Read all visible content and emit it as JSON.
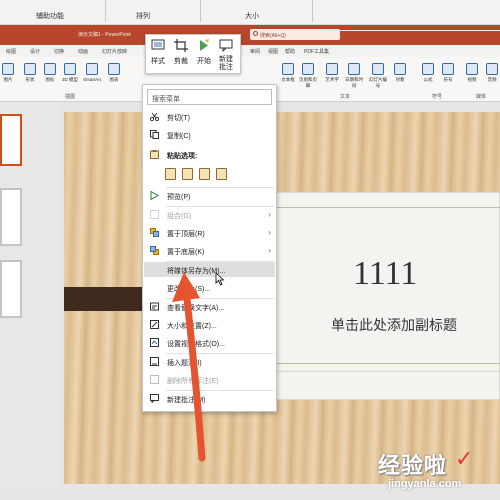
{
  "top_strip": {
    "group1": "辅助功能",
    "group2": "排列",
    "group3": "大小"
  },
  "titlebar": {
    "title": "演示文稿1 - PowerPoint",
    "search_placeholder": "搜索(Alt+Q)"
  },
  "tabs": [
    "绘图",
    "设计",
    "切换",
    "动画",
    "幻灯片放映",
    "审阅",
    "视图",
    "帮助",
    "PDF工具集"
  ],
  "ribbon": {
    "items": [
      "图片",
      "形状",
      "图标",
      "3D 模型",
      "SmartArt",
      "图表",
      "文本框",
      "页眉和页脚",
      "艺术字",
      "日期和时间",
      "幻灯片编号",
      "对象",
      "公式",
      "符号",
      "视频",
      "音频"
    ],
    "groups": {
      "illustrations": "插图",
      "text": "文本",
      "symbols": "符号",
      "media": "媒体"
    }
  },
  "mini_toolbar": {
    "style": "样式",
    "crop": "剪裁",
    "start": "开始",
    "new_comment": "新建批注"
  },
  "slide": {
    "title": "1111",
    "subtitle": "单击此处添加副标题"
  },
  "context_menu": {
    "search_placeholder": "搜索菜单",
    "items": {
      "cut": "剪切(T)",
      "copy": "复制(C)",
      "paste_options": "粘贴选项:",
      "preview": "预览(P)",
      "group": "组合(G)",
      "bring_front": "置于顶层(R)",
      "send_back": "置于底层(K)",
      "save_as_picture": "将媒体另存为(M)...",
      "change_picture": "更改图片(S)...",
      "edit_alt_text": "查看替换文字(A)...",
      "size_position": "大小和位置(Z)...",
      "format_video": "设置视频格式(O)...",
      "insert_caption": "插入题注(I)",
      "remove_captions": "删除所有标注(E)",
      "new_comment": "新建批注(M)"
    }
  },
  "watermark": {
    "line1": "经验啦",
    "check": "✓",
    "line2": "jingyanla.com"
  },
  "colors": {
    "titlebar": "#b7472a",
    "accent": "#c9501f",
    "arrow": "#e5532f"
  }
}
